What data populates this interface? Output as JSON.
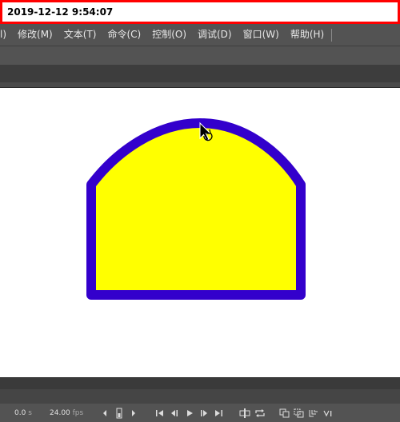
{
  "timestamp": "2019-12-12 9:54:07",
  "menu": {
    "items": [
      "l)",
      "修改(M)",
      "文本(T)",
      "命令(C)",
      "控制(O)",
      "调试(D)",
      "窗口(W)",
      "帮助(H)"
    ]
  },
  "canvas": {
    "shape_fill": "#ffff00",
    "shape_stroke": "#3300cc"
  },
  "timeline": {
    "time_value": "0.0",
    "time_unit": "s",
    "fps_value": "24.00",
    "fps_unit": "fps"
  },
  "icons": [
    "chevron-left-icon",
    "frame-marker-icon",
    "chevron-right-icon",
    "go-first-frame-icon",
    "step-back-icon",
    "play-icon",
    "step-forward-icon",
    "go-last-frame-icon",
    "center-frame-icon",
    "loop-icon",
    "onion-skin-icon",
    "onion-skin-outlines-icon",
    "edit-multiple-frames-icon",
    "modify-markers-icon"
  ]
}
